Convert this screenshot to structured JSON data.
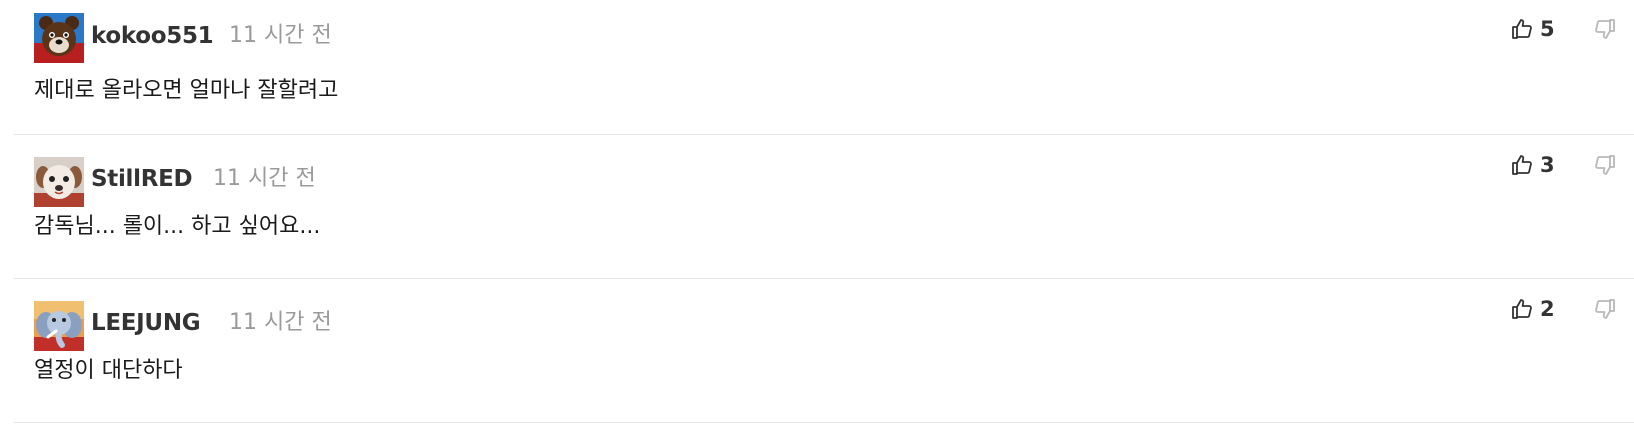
{
  "comments": [
    {
      "username": "kokoo551",
      "timestamp": "11 시간 전",
      "text": "제대로 올라오면 얼마나 잘할려고",
      "likes": "5",
      "avatar": "bear-avatar"
    },
    {
      "username": "StillRED",
      "timestamp": "11 시간 전",
      "text": "감독님... 롤이... 하고 싶어요...",
      "likes": "3",
      "avatar": "dog-avatar"
    },
    {
      "username": "LEEJUNG",
      "timestamp": "11 시간 전",
      "text": "열정이 대단하다",
      "likes": "2",
      "avatar": "elephant-avatar"
    }
  ],
  "colors": {
    "username": "#333333",
    "timestamp": "#9a9a9a",
    "divider": "#e6e6e6",
    "icon": "#333333",
    "icon_muted": "#b8b8b8"
  }
}
